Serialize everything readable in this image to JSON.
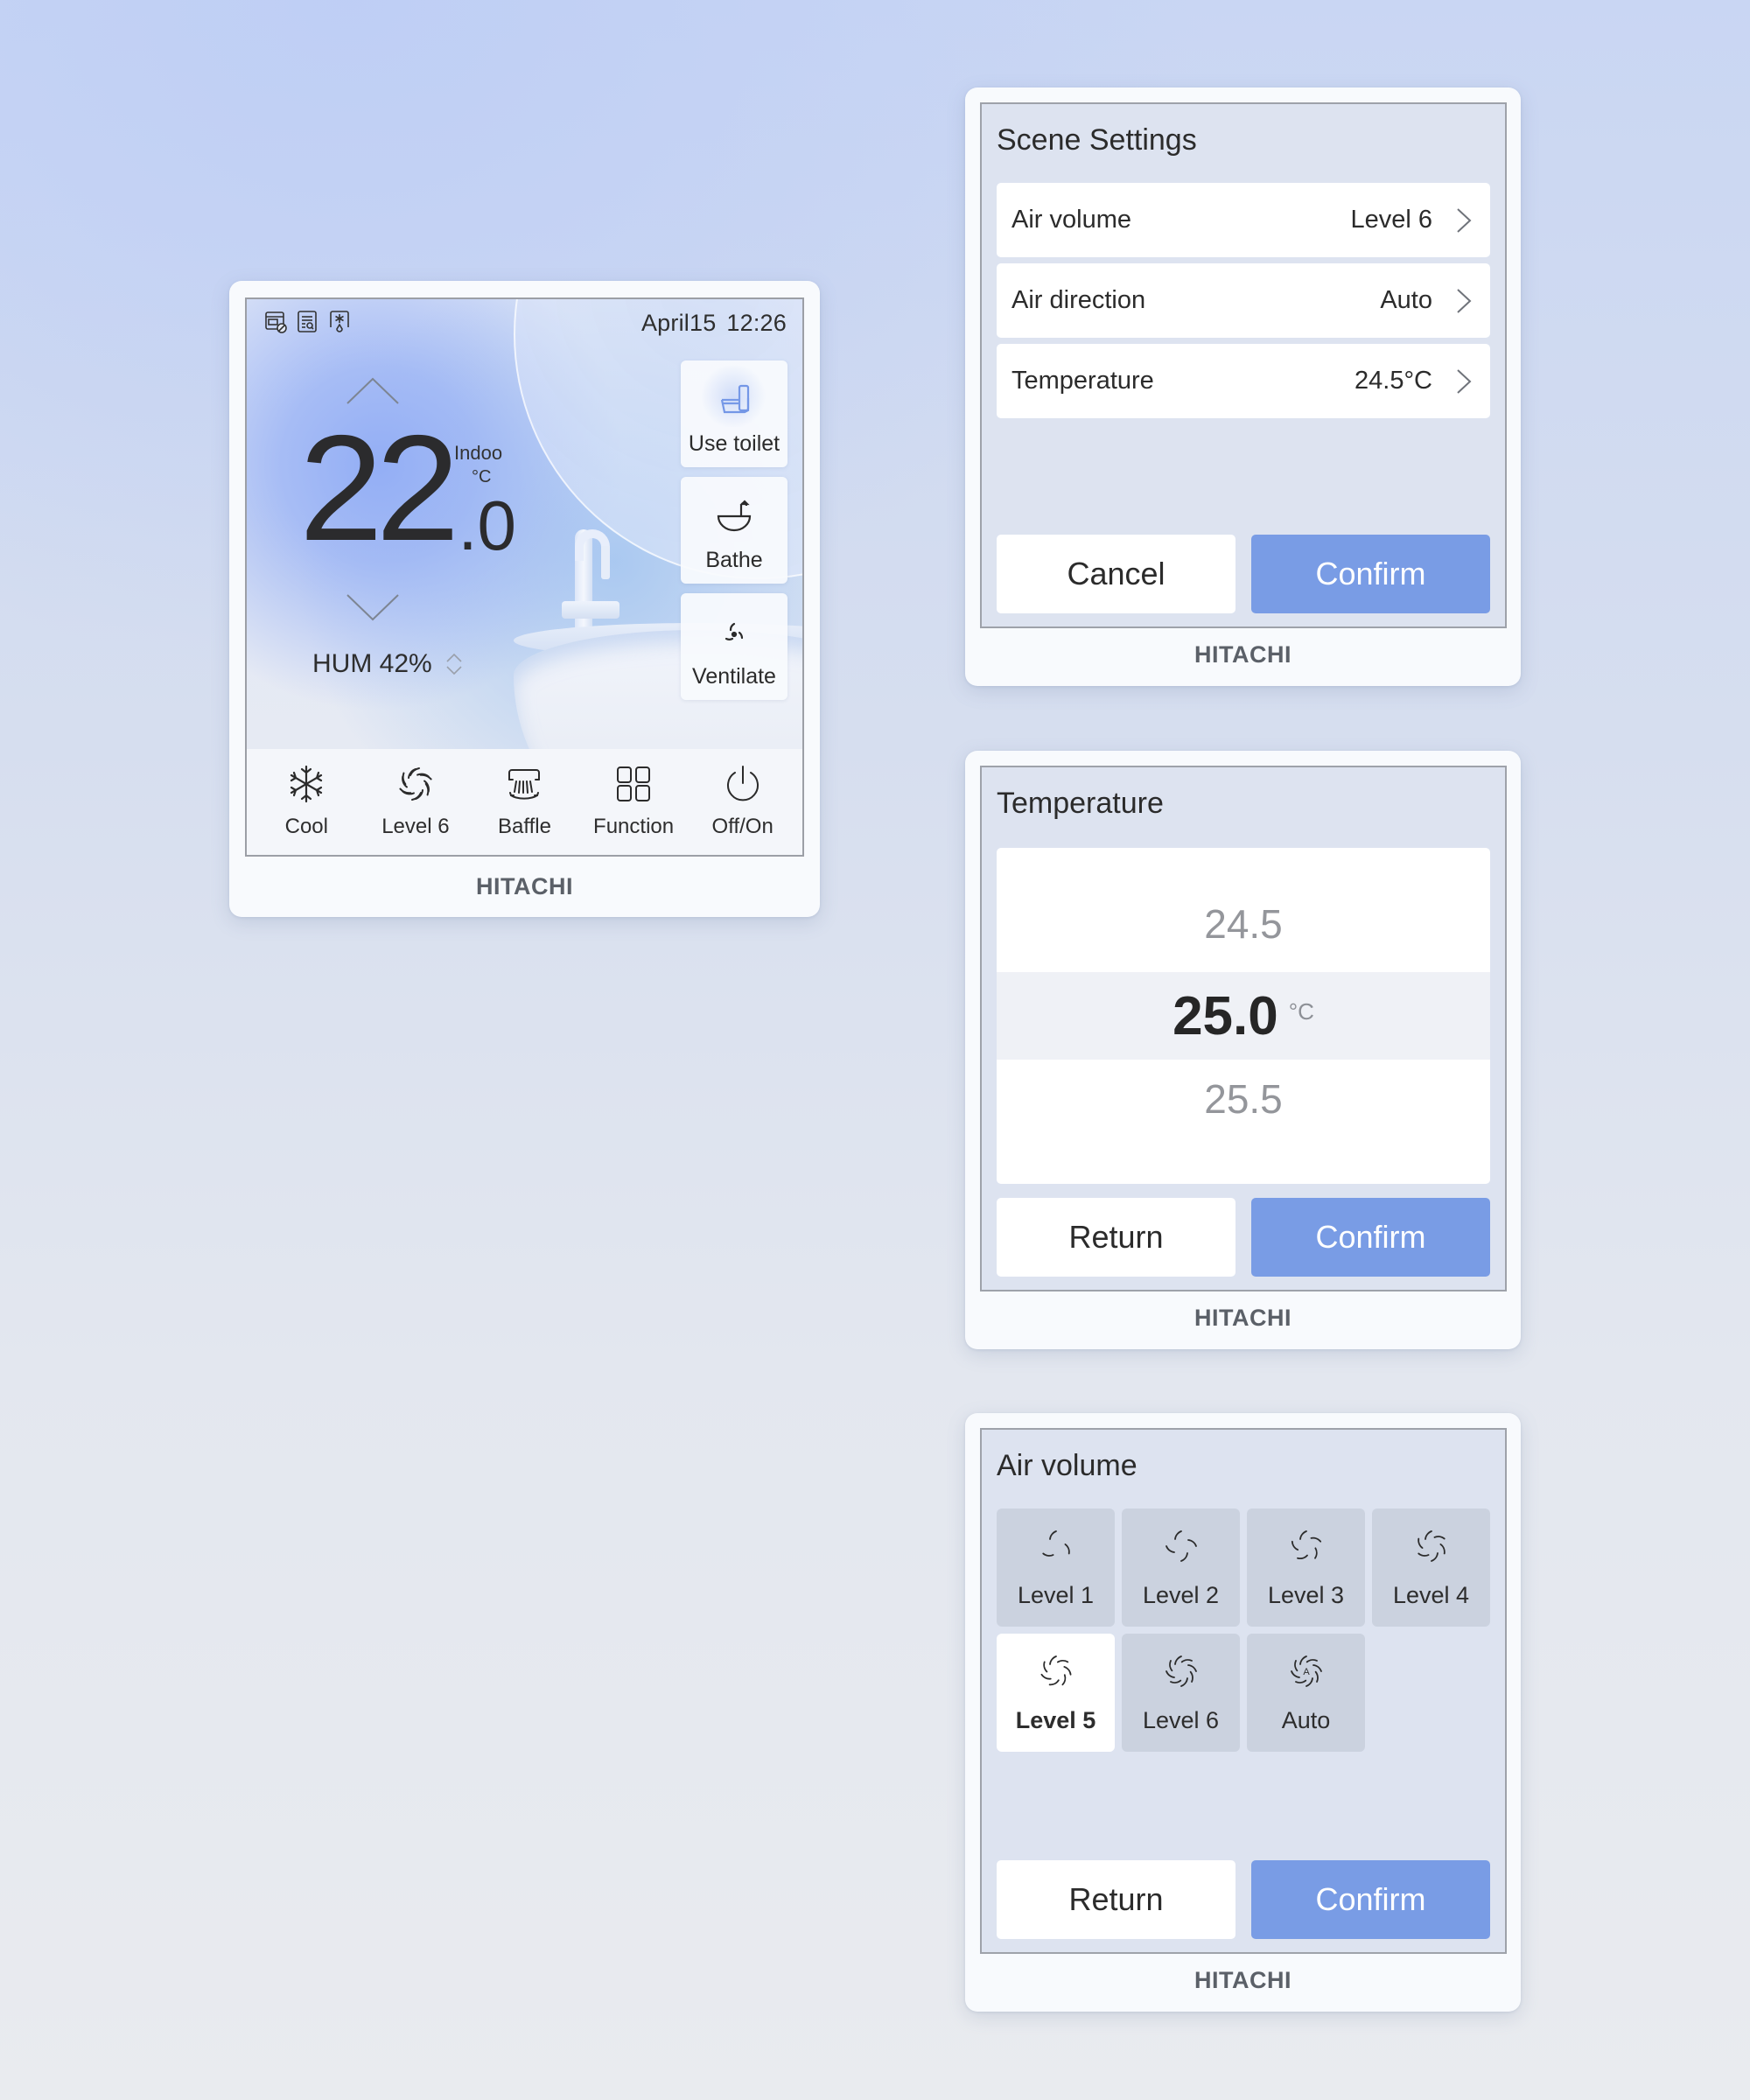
{
  "home": {
    "status_icons": [
      "filter-blocked-icon",
      "report-search-icon",
      "defrost-icon"
    ],
    "date": "April15",
    "time": "12:26",
    "temperature_int": "22",
    "temperature_dec": ".0",
    "indoor_label": "Indoo",
    "unit": "°C",
    "humidity": "HUM 42%",
    "scenes": [
      {
        "label": "Use toilet",
        "icon": "toilet-icon"
      },
      {
        "label": "Bathe",
        "icon": "bathtub-icon"
      },
      {
        "label": "Ventilate",
        "icon": "ventilate-fan-icon"
      }
    ],
    "nav": [
      {
        "label": "Cool",
        "icon": "snowflake-icon"
      },
      {
        "label": "Level 6",
        "icon": "fan-icon"
      },
      {
        "label": "Baffle",
        "icon": "baffle-icon"
      },
      {
        "label": "Function",
        "icon": "grid-icon"
      },
      {
        "label": "Off/On",
        "icon": "power-icon"
      }
    ],
    "brand": "HITACHI"
  },
  "scene_settings": {
    "title": "Scene Settings",
    "rows": [
      {
        "label": "Air volume",
        "value": "Level 6"
      },
      {
        "label": "Air direction",
        "value": "Auto"
      },
      {
        "label": "Temperature",
        "value": "24.5°C"
      }
    ],
    "cancel": "Cancel",
    "confirm": "Confirm",
    "brand": "HITACHI"
  },
  "temperature_picker": {
    "title": "Temperature",
    "prev": "24.5",
    "selected": "25.0",
    "unit": "°C",
    "next": "25.5",
    "return": "Return",
    "confirm": "Confirm",
    "brand": "HITACHI"
  },
  "air_volume": {
    "title": "Air volume",
    "options": [
      {
        "label": "Level 1",
        "selected": false
      },
      {
        "label": "Level 2",
        "selected": false
      },
      {
        "label": "Level 3",
        "selected": false
      },
      {
        "label": "Level 4",
        "selected": false
      },
      {
        "label": "Level 5",
        "selected": true
      },
      {
        "label": "Level 6",
        "selected": false
      },
      {
        "label": "Auto",
        "selected": false
      }
    ],
    "return": "Return",
    "confirm": "Confirm",
    "brand": "HITACHI"
  },
  "colors": {
    "accent": "#799ce5",
    "panel_bg": "#dde3f0",
    "tile_bg": "#cbd2df"
  }
}
